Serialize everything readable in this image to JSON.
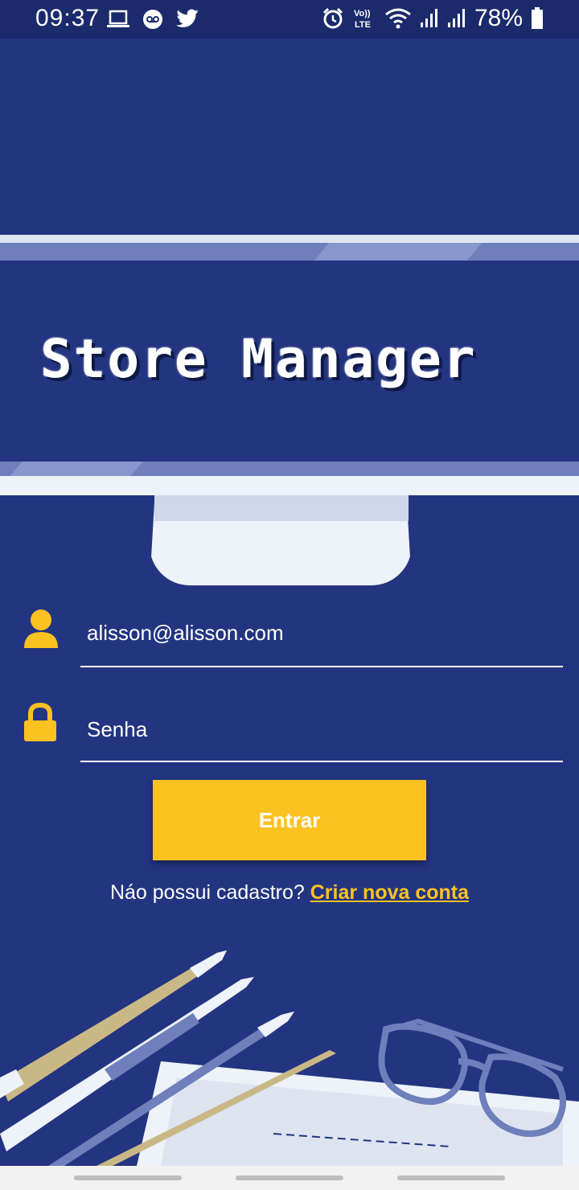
{
  "status_bar": {
    "time": "09:37",
    "battery": "78%",
    "left_icons": [
      "laptop-icon",
      "voicemail-icon",
      "twitter-icon"
    ],
    "right_icons": [
      "alarm-icon",
      "volte-icon",
      "wifi-icon",
      "signal-icon",
      "signal-icon",
      "battery-icon"
    ],
    "volte_label_top": "Vo))",
    "volte_label_bottom": "LTE"
  },
  "app": {
    "title": "Store Manager"
  },
  "login_form": {
    "email_value": "alisson@alisson.com",
    "password_placeholder": "Senha",
    "submit_label": "Entrar"
  },
  "register": {
    "prompt": "Náo possui cadastro?",
    "link_label": "Criar nova conta"
  },
  "colors": {
    "background": "#233580",
    "status_bar": "#1b2a6b",
    "accent": "#fcc221",
    "text": "#ffffff"
  }
}
